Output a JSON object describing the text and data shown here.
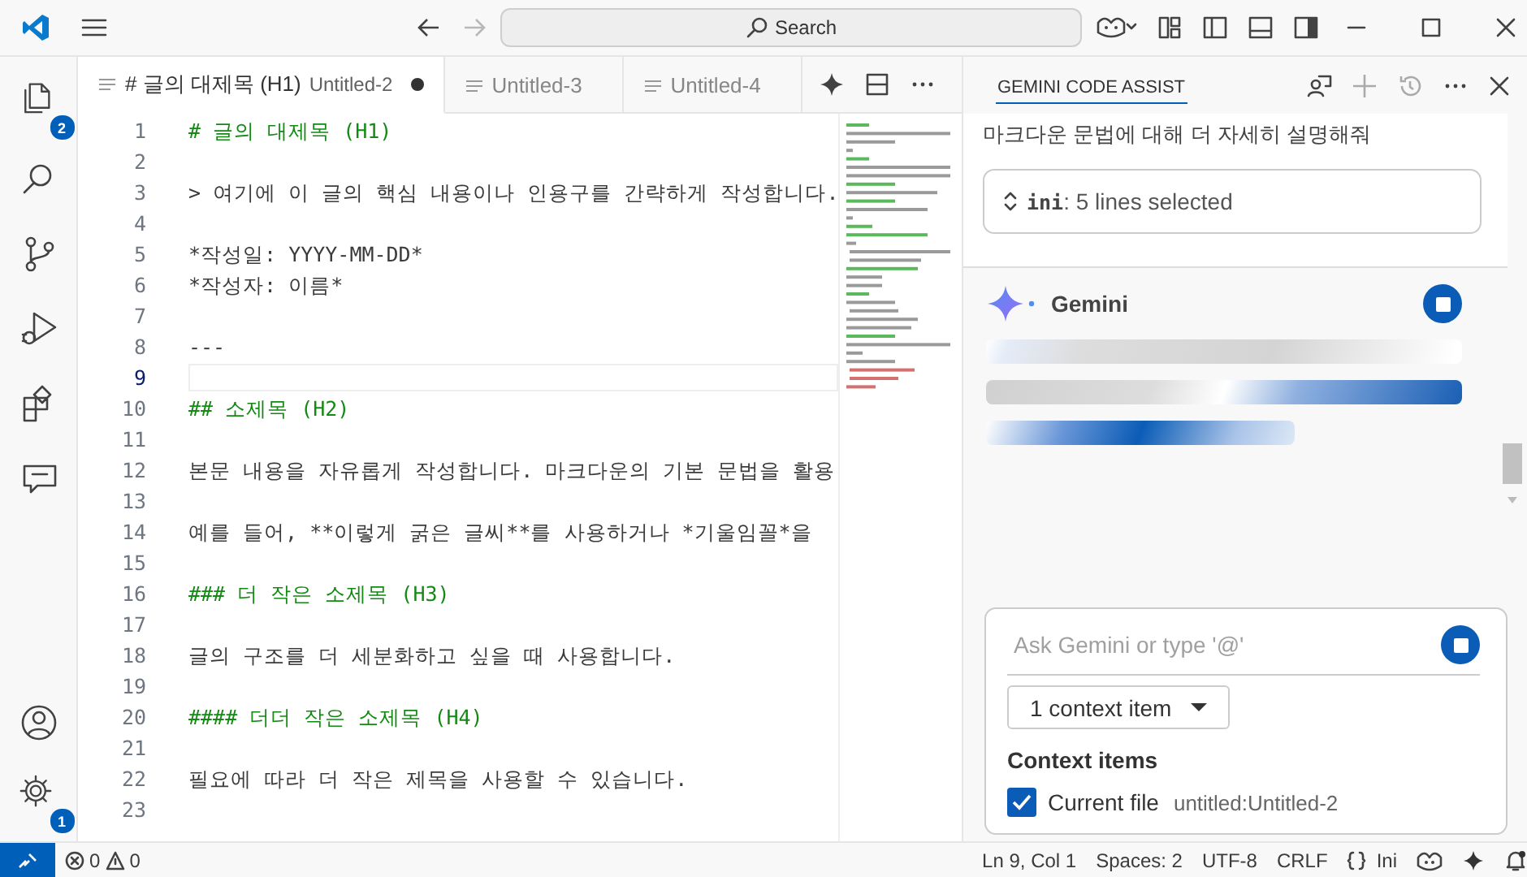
{
  "title_bar": {
    "search_label": "Search",
    "back_disabled": false,
    "forward_disabled": true
  },
  "activity_bar": {
    "items": [
      {
        "kind": "explorer",
        "badge": "2"
      },
      {
        "kind": "search"
      },
      {
        "kind": "source-control"
      },
      {
        "kind": "run"
      },
      {
        "kind": "extensions"
      },
      {
        "kind": "chat"
      }
    ],
    "bottom_items": [
      {
        "kind": "account"
      },
      {
        "kind": "settings",
        "badge": "1"
      }
    ]
  },
  "editor": {
    "tabs": [
      {
        "title": "# 글의 대제목 (H1)",
        "description": "Untitled-2",
        "selected": true,
        "dirty": true
      },
      {
        "title": "Untitled-3",
        "selected": false,
        "dirty": false
      },
      {
        "title": "Untitled-4",
        "selected": false,
        "dirty": false
      }
    ],
    "lines": [
      {
        "number": "1",
        "kind": "heading",
        "text": "# 글의 대제목 (H1)",
        "current": false
      },
      {
        "number": "2",
        "kind": "empty",
        "current": false
      },
      {
        "number": "3",
        "kind": "text",
        "text": "> 여기에 이 글의 핵심 내용이나 인용구를 간략하게 작성합니다.",
        "current": false
      },
      {
        "number": "4",
        "kind": "empty",
        "current": false
      },
      {
        "number": "5",
        "kind": "text",
        "text": "*작성일: YYYY-MM-DD*",
        "current": false
      },
      {
        "number": "6",
        "kind": "text",
        "text": "*작성자: 이름*",
        "current": false
      },
      {
        "number": "7",
        "kind": "empty",
        "current": false
      },
      {
        "number": "8",
        "kind": "text",
        "text": "---",
        "current": false
      },
      {
        "number": "9",
        "kind": "empty",
        "current": true
      },
      {
        "number": "10",
        "kind": "heading",
        "text": "## 소제목 (H2)",
        "current": false
      },
      {
        "number": "11",
        "kind": "empty",
        "current": false
      },
      {
        "number": "12",
        "kind": "text",
        "text": "본문 내용을 자유롭게 작성합니다. 마크다운의 기본 문법을 활용",
        "current": false
      },
      {
        "number": "13",
        "kind": "empty",
        "current": false
      },
      {
        "number": "14",
        "kind": "text",
        "text": "예를 들어, **이렇게 굵은 글씨**를 사용하거나 *기울임꼴*을",
        "current": false
      },
      {
        "number": "15",
        "kind": "empty",
        "current": false
      },
      {
        "number": "16",
        "kind": "heading",
        "text": "### 더 작은 소제목 (H3)",
        "current": false
      },
      {
        "number": "17",
        "kind": "empty",
        "current": false
      },
      {
        "number": "18",
        "kind": "text",
        "text": "글의 구조를 더 세분화하고 싶을 때 사용합니다.",
        "current": false
      },
      {
        "number": "19",
        "kind": "empty",
        "current": false
      },
      {
        "number": "20",
        "kind": "heading",
        "text": "#### 더더 작은 소제목 (H4)",
        "current": false
      },
      {
        "number": "21",
        "kind": "empty",
        "current": false
      },
      {
        "number": "22",
        "kind": "text",
        "text": "필요에 따라 더 작은 제목을 사용할 수 있습니다.",
        "current": false
      },
      {
        "number": "23",
        "kind": "empty",
        "current": false
      }
    ]
  },
  "chat_panel": {
    "title": "GEMINI CODE ASSIST",
    "user_message": "마크다운 문법에 대해 더 자세히 설명해줘",
    "selection_chip": {
      "language": "ini",
      "summary": ": 5 lines selected"
    },
    "response": {
      "author": "Gemini",
      "loading": true
    },
    "input": {
      "placeholder": "Ask Gemini or type '@'",
      "context_button": "1 context item",
      "context_heading": "Context items",
      "context_items": [
        {
          "label": "Current file",
          "detail": "untitled:Untitled-2",
          "checked": true
        }
      ]
    }
  },
  "status_bar": {
    "errors": "0",
    "warnings": "0",
    "items": [
      "Ln 9, Col 1",
      "Spaces: 2",
      "UTF-8",
      "CRLF"
    ],
    "language": "Ini"
  }
}
